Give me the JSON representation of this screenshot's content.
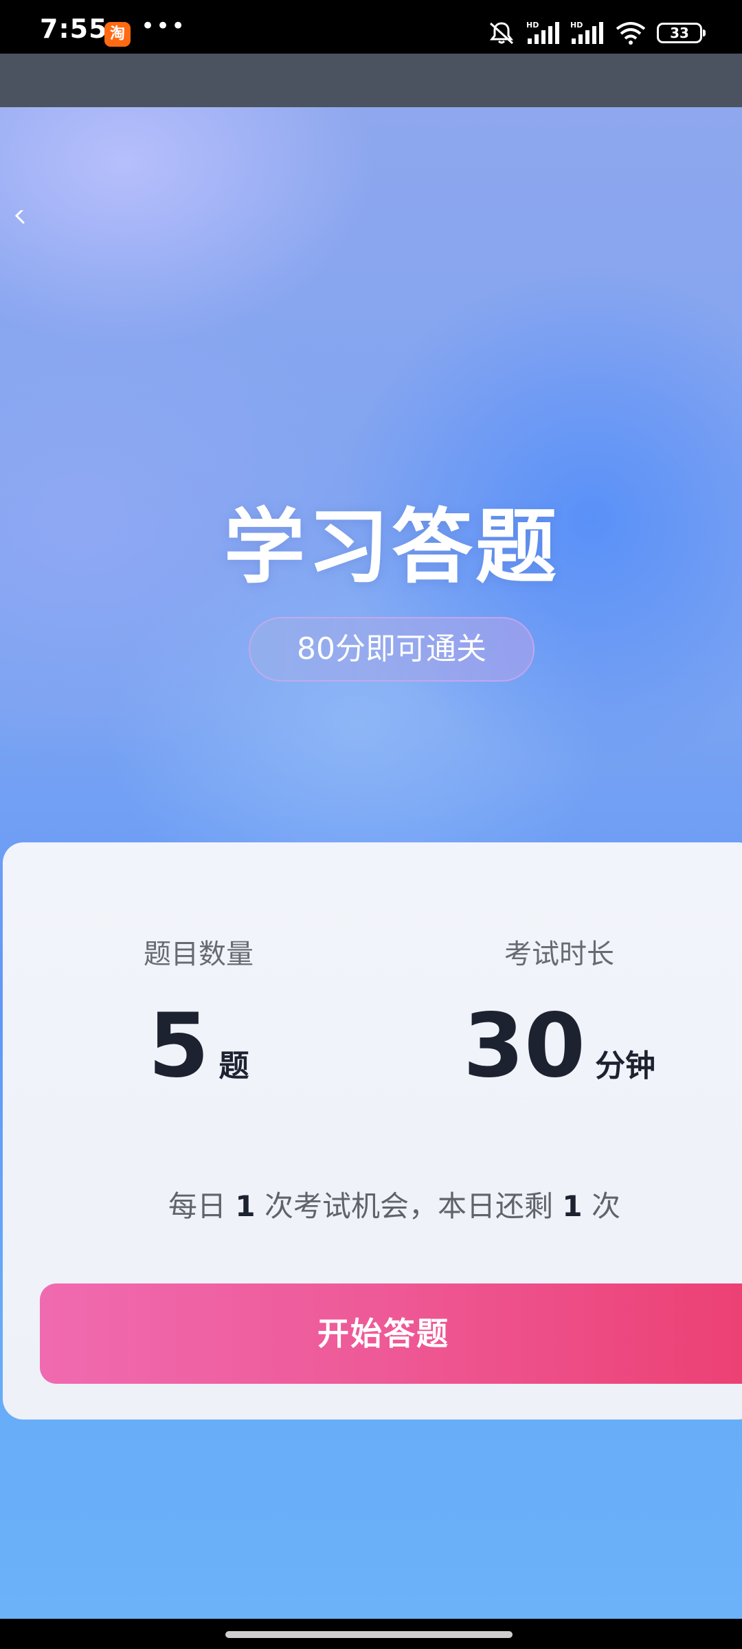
{
  "status_bar": {
    "time": "7:55",
    "app_badge": "淘",
    "more_dots": "•••",
    "battery_level": "33",
    "icons": [
      "mute-icon",
      "signal-hd-icon",
      "signal-hd-icon",
      "wifi-icon",
      "battery-icon"
    ]
  },
  "hero": {
    "title": "学习答题",
    "pass_condition": "80分即可通关"
  },
  "card": {
    "count": {
      "label": "题目数量",
      "value": "5",
      "unit": "题"
    },
    "duration": {
      "label": "考试时长",
      "value": "30",
      "unit": "分钟"
    },
    "daily_note": {
      "prefix": "每日",
      "daily_times": "1",
      "middle": "次考试机会，本日还剩",
      "remaining_times": "1",
      "suffix": "次"
    },
    "start_button": "开始答题"
  },
  "colors": {
    "button_start": "#f06ab0",
    "button_end": "#ec3f72",
    "card_bg": "#f2f4fb",
    "header_band": "#4b5360"
  }
}
